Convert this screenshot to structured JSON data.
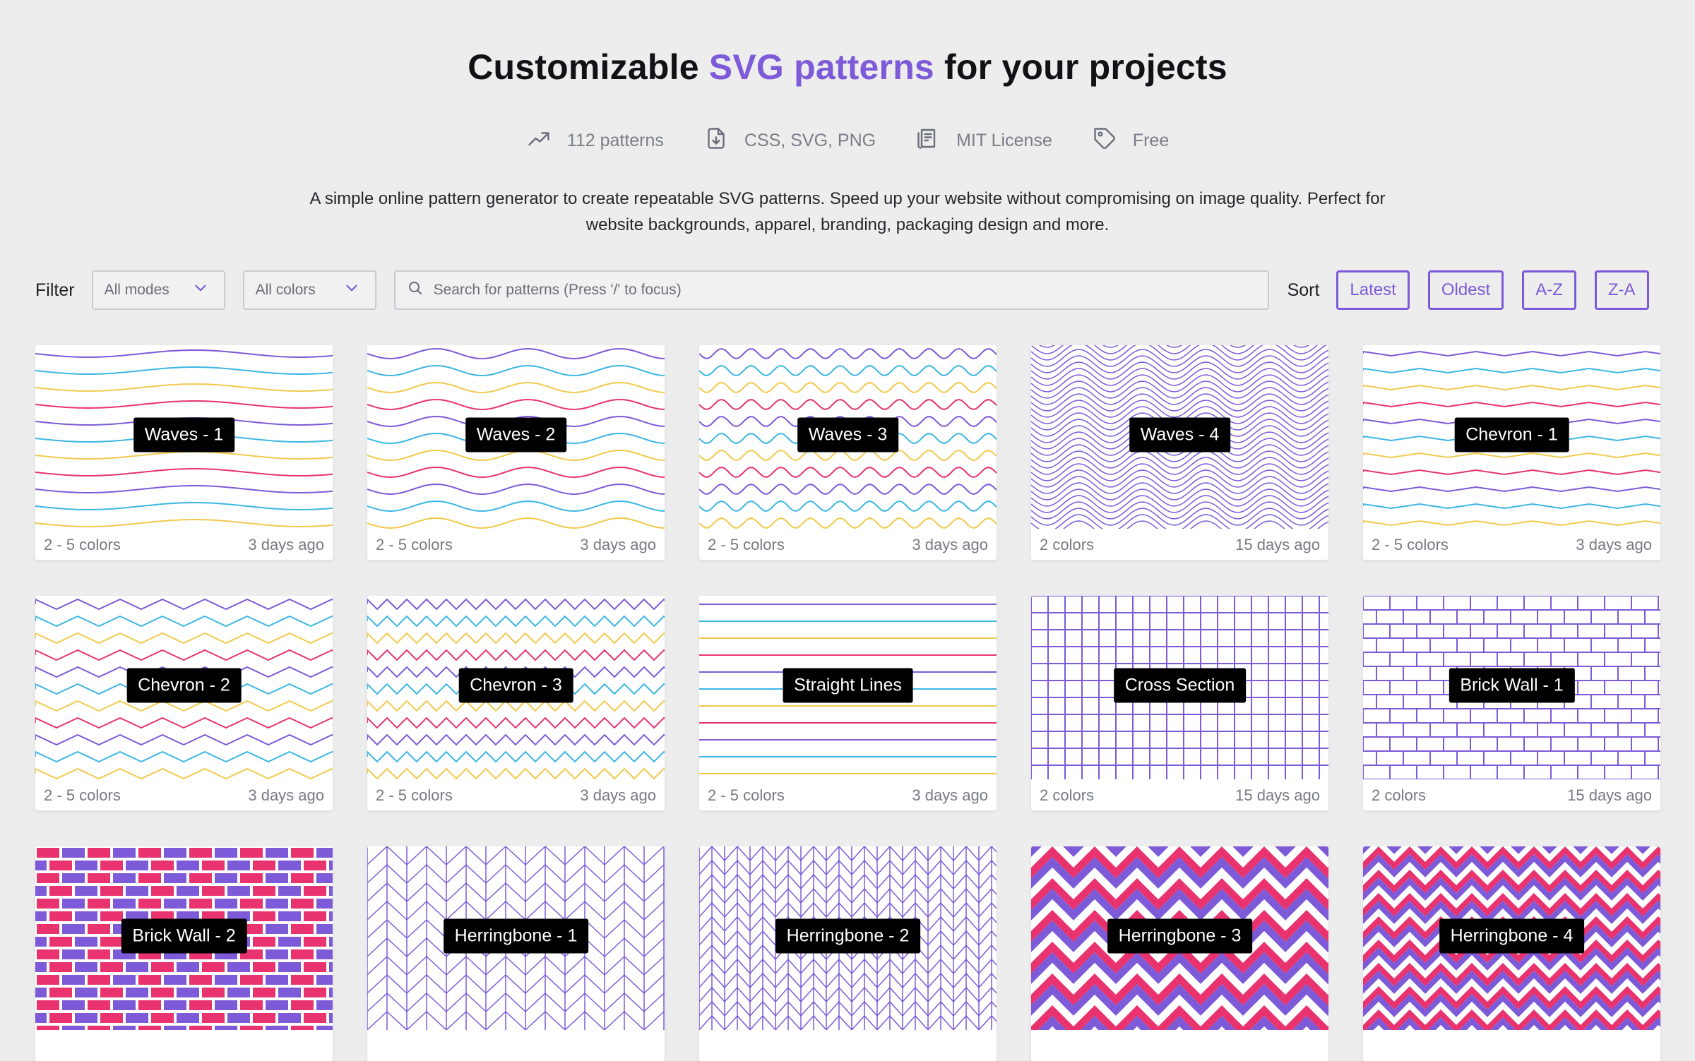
{
  "header": {
    "title_prefix": "Customizable ",
    "title_accent": "SVG patterns",
    "title_suffix": " for your projects",
    "accent_color": "#7d5ad8"
  },
  "stats": [
    {
      "icon": "trending-up-icon",
      "label": "112 patterns"
    },
    {
      "icon": "file-download-icon",
      "label": "CSS, SVG, PNG"
    },
    {
      "icon": "license-icon",
      "label": "MIT License"
    },
    {
      "icon": "price-tag-icon",
      "label": "Free"
    }
  ],
  "description": "A simple online pattern generator to create repeatable SVG patterns. Speed up your website without compromising on image quality. Perfect for website backgrounds, apparel, branding, packaging design and more.",
  "toolbar": {
    "filter_label": "Filter",
    "modes_select": "All modes",
    "colors_select": "All colors",
    "search_placeholder": "Search for patterns (Press '/' to focus)",
    "sort_label": "Sort",
    "sort_options": [
      "Latest",
      "Oldest",
      "A-Z",
      "Z-A"
    ]
  },
  "palette": {
    "purple": "#7d5ad8",
    "cyan": "#3cb6e3",
    "yellow": "#f2c94c",
    "pink": "#e8336e"
  },
  "patterns": [
    {
      "name": "Waves - 1",
      "colors": "2 - 5 colors",
      "date": "3 days ago",
      "style": "waves1"
    },
    {
      "name": "Waves - 2",
      "colors": "2 - 5 colors",
      "date": "3 days ago",
      "style": "waves2"
    },
    {
      "name": "Waves - 3",
      "colors": "2 - 5 colors",
      "date": "3 days ago",
      "style": "waves3"
    },
    {
      "name": "Waves - 4",
      "colors": "2 colors",
      "date": "15 days ago",
      "style": "waves4"
    },
    {
      "name": "Chevron - 1",
      "colors": "2 - 5 colors",
      "date": "3 days ago",
      "style": "chevron1"
    },
    {
      "name": "Chevron - 2",
      "colors": "2 - 5 colors",
      "date": "3 days ago",
      "style": "chevron2"
    },
    {
      "name": "Chevron - 3",
      "colors": "2 - 5 colors",
      "date": "3 days ago",
      "style": "chevron3"
    },
    {
      "name": "Straight Lines",
      "colors": "2 - 5 colors",
      "date": "3 days ago",
      "style": "lines"
    },
    {
      "name": "Cross Section",
      "colors": "2 colors",
      "date": "15 days ago",
      "style": "grid"
    },
    {
      "name": "Brick Wall - 1",
      "colors": "2 colors",
      "date": "15 days ago",
      "style": "brick1"
    },
    {
      "name": "Brick Wall - 2",
      "colors": "",
      "date": "",
      "style": "brick2"
    },
    {
      "name": "Herringbone - 1",
      "colors": "",
      "date": "",
      "style": "herring1"
    },
    {
      "name": "Herringbone - 2",
      "colors": "",
      "date": "",
      "style": "herring2"
    },
    {
      "name": "Herringbone - 3",
      "colors": "",
      "date": "",
      "style": "herring3"
    },
    {
      "name": "Herringbone - 4",
      "colors": "",
      "date": "",
      "style": "herring4"
    }
  ]
}
